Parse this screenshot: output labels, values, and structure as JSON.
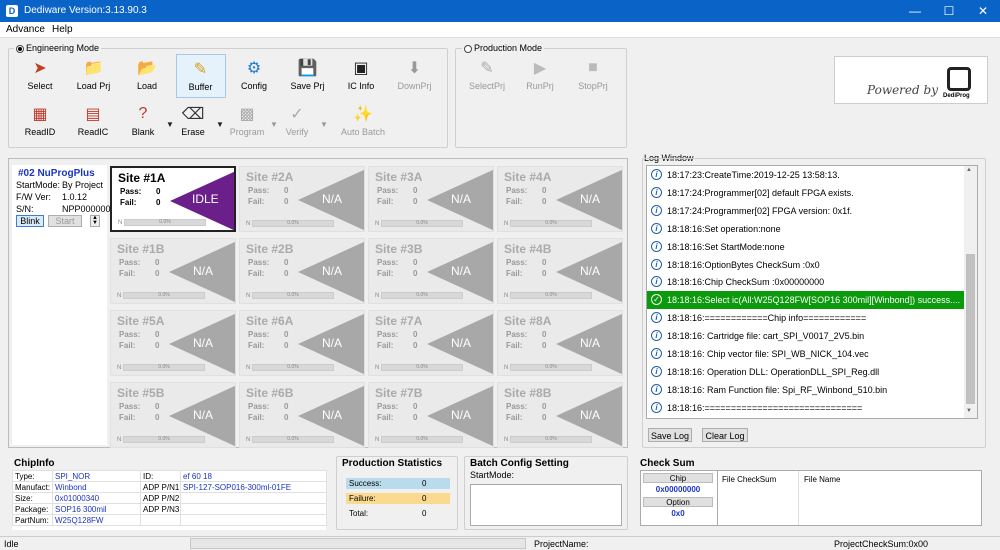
{
  "window": {
    "title": "Dediware Version:3.13.90.3"
  },
  "menu": [
    "Advance",
    "Help"
  ],
  "engineering": {
    "label": "Engineering Mode",
    "row1": [
      {
        "label": "Select",
        "icon": "select-icon",
        "disabled": false
      },
      {
        "label": "Load Prj",
        "icon": "load-project-icon",
        "disabled": false
      },
      {
        "label": "Load",
        "icon": "load-icon",
        "disabled": false
      },
      {
        "label": "Buffer",
        "icon": "buffer-icon",
        "disabled": false,
        "selected": true
      },
      {
        "label": "Config",
        "icon": "config-gear-icon",
        "disabled": false
      },
      {
        "label": "Save Prj",
        "icon": "save-project-icon",
        "disabled": false
      },
      {
        "label": "IC Info",
        "icon": "ic-info-icon",
        "disabled": false
      },
      {
        "label": "DownPrj",
        "icon": "download-project-icon",
        "disabled": true
      }
    ],
    "row2": [
      {
        "label": "ReadID",
        "icon": "read-id-icon",
        "disabled": false,
        "dropdown": false
      },
      {
        "label": "ReadIC",
        "icon": "read-ic-icon",
        "disabled": false,
        "dropdown": false
      },
      {
        "label": "Blank",
        "icon": "blank-check-icon",
        "disabled": false,
        "dropdown": true
      },
      {
        "label": "Erase",
        "icon": "erase-icon",
        "disabled": false,
        "dropdown": true
      },
      {
        "label": "Program",
        "icon": "program-icon",
        "disabled": true,
        "dropdown": true
      },
      {
        "label": "Verify",
        "icon": "verify-icon",
        "disabled": true,
        "dropdown": true
      },
      {
        "label": "Auto Batch",
        "icon": "auto-batch-icon",
        "disabled": true,
        "dropdown": false
      }
    ]
  },
  "production": {
    "label": "Production Mode",
    "tools": [
      {
        "label": "SelectPrj",
        "icon": "select-project-icon"
      },
      {
        "label": "RunPrj",
        "icon": "run-project-icon"
      },
      {
        "label": "StopPrj",
        "icon": "stop-project-icon"
      }
    ]
  },
  "logo": {
    "text": "Powered by",
    "brand": "DediProg"
  },
  "programmer": {
    "title": "#02 NuProgPlus",
    "startmode_label": "StartMode:",
    "startmode": "By Project",
    "fw_label": "F/W Ver:",
    "fw": "1.0.12",
    "sn_label": "S/N:",
    "sn": "NPP000000",
    "blink": "Blink",
    "start": "Start"
  },
  "sites": [
    {
      "name": "Site #1A",
      "pass": "0",
      "fail": "0",
      "status": "IDLE",
      "active": true,
      "progress": 0
    },
    {
      "name": "Site #2A",
      "pass": "0",
      "fail": "0",
      "status": "N/A",
      "active": false,
      "progress": 0
    },
    {
      "name": "Site #3A",
      "pass": "0",
      "fail": "0",
      "status": "N/A",
      "active": false,
      "progress": 0
    },
    {
      "name": "Site #4A",
      "pass": "0",
      "fail": "0",
      "status": "N/A",
      "active": false,
      "progress": 0
    },
    {
      "name": "Site #1B",
      "pass": "0",
      "fail": "0",
      "status": "N/A",
      "active": false,
      "progress": 0
    },
    {
      "name": "Site #2B",
      "pass": "0",
      "fail": "0",
      "status": "N/A",
      "active": false,
      "progress": 0
    },
    {
      "name": "Site #3B",
      "pass": "0",
      "fail": "0",
      "status": "N/A",
      "active": false,
      "progress": 0
    },
    {
      "name": "Site #4B",
      "pass": "0",
      "fail": "0",
      "status": "N/A",
      "active": false,
      "progress": 0
    },
    {
      "name": "Site #5A",
      "pass": "0",
      "fail": "0",
      "status": "N/A",
      "active": false,
      "progress": 0
    },
    {
      "name": "Site #6A",
      "pass": "0",
      "fail": "0",
      "status": "N/A",
      "active": false,
      "progress": 0
    },
    {
      "name": "Site #7A",
      "pass": "0",
      "fail": "0",
      "status": "N/A",
      "active": false,
      "progress": 0
    },
    {
      "name": "Site #8A",
      "pass": "0",
      "fail": "0",
      "status": "N/A",
      "active": false,
      "progress": 0
    },
    {
      "name": "Site #5B",
      "pass": "0",
      "fail": "0",
      "status": "N/A",
      "active": false,
      "progress": 0
    },
    {
      "name": "Site #6B",
      "pass": "0",
      "fail": "0",
      "status": "N/A",
      "active": false,
      "progress": 0
    },
    {
      "name": "Site #7B",
      "pass": "0",
      "fail": "0",
      "status": "N/A",
      "active": false,
      "progress": 0
    },
    {
      "name": "Site #8B",
      "pass": "0",
      "fail": "0",
      "status": "N/A",
      "active": false,
      "progress": 0
    }
  ],
  "site_labels": {
    "pass": "Pass:",
    "fail": "Fail:",
    "n": "N",
    "pct": "0.0%"
  },
  "log": {
    "title": "Log Window",
    "lines": [
      {
        "text": "18:17:23:CreateTime:2019-12-25 13:58:13.",
        "ok": false
      },
      {
        "text": "18:17:24:Programmer[02] default FPGA exists.",
        "ok": false
      },
      {
        "text": "18:17:24:Programmer[02] FPGA version: 0x1f.",
        "ok": false
      },
      {
        "text": "18:18:16:Set operation:none",
        "ok": false
      },
      {
        "text": "18:18:16:Set StartMode:none",
        "ok": false
      },
      {
        "text": "18:18:16:OptionBytes CheckSum :0x0",
        "ok": false
      },
      {
        "text": "18:18:16:Chip CheckSum :0x00000000",
        "ok": false
      },
      {
        "text": "18:18:16:Select ic(All:W25Q128FW[SOP16 300mil][Winbond]) success....",
        "ok": true
      },
      {
        "text": "18:18:16:============Chip info============",
        "ok": false
      },
      {
        "text": "18:18:16:  Cartridge file: cart_SPI_V0017_2V5.bin",
        "ok": false
      },
      {
        "text": "18:18:16:  Chip vector file: SPI_WB_NICK_104.vec",
        "ok": false
      },
      {
        "text": "18:18:16:  Operation DLL: OperationDLL_SPI_Reg.dll",
        "ok": false
      },
      {
        "text": "18:18:16:  Ram Function file: Spi_RF_Winbond_510.bin",
        "ok": false
      },
      {
        "text": "18:18:16:==============================",
        "ok": false
      }
    ],
    "save": "Save Log",
    "clear": "Clear Log"
  },
  "chipinfo": {
    "title": "ChipInfo",
    "rows": [
      [
        "Type:",
        "SPI_NOR",
        "ID:",
        "ef 60 18"
      ],
      [
        "Manufact:",
        "Winbond",
        "ADP P/N1:",
        "SPI-127-SOP016-300ml-01FE"
      ],
      [
        "Size:",
        "0x01000340",
        "ADP P/N2:",
        ""
      ],
      [
        "Package:",
        "SOP16 300mil",
        "ADP P/N3:",
        ""
      ],
      [
        "PartNum:",
        "W25Q128FW",
        "",
        ""
      ]
    ]
  },
  "prodstats": {
    "title": "Production Statistics",
    "rows": [
      {
        "label": "Success:",
        "value": "0",
        "color": "#b8dcec"
      },
      {
        "label": "Failure:",
        "value": "0",
        "color": "#fbd98f"
      },
      {
        "label": "Total:",
        "value": "0",
        "color": ""
      }
    ]
  },
  "batch": {
    "title": "Batch Config Setting",
    "startmode": "StartMode:"
  },
  "checksum": {
    "title": "Check Sum",
    "chip_label": "Chip",
    "chip_value": "0x00000000",
    "option_label": "Option",
    "option_value": "0x0",
    "col1": "File CheckSum",
    "col2": "File Name"
  },
  "status": {
    "state": "Idle",
    "project_name": "ProjectName:",
    "project_checksum": "ProjectCheckSum:0x00"
  }
}
